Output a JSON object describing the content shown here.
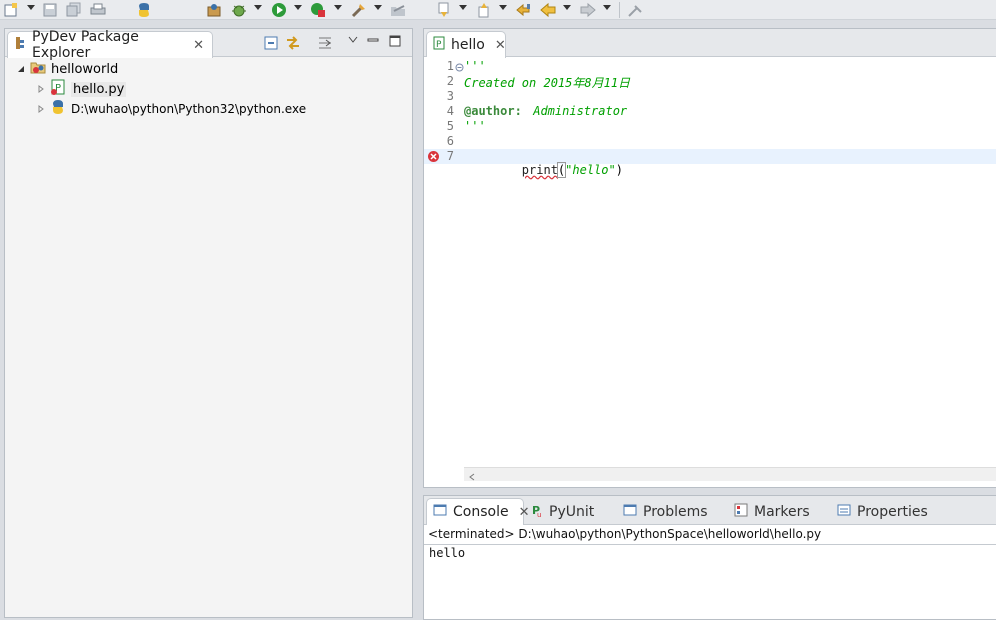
{
  "toolbar": {
    "items": [
      "new-icon",
      "save-icon",
      "save-all-icon",
      "print-icon",
      "python-icon",
      "package-icon",
      "debug-icon",
      "run-icon",
      "coverage-icon",
      "external-tools-icon",
      "open-icon",
      "next-annotation-icon",
      "prev-annotation-icon",
      "last-edit-icon",
      "back-icon",
      "forward-icon",
      "pin-icon"
    ]
  },
  "explorer": {
    "tab_label": "PyDev Package Explorer",
    "project": "helloworld",
    "file": "hello.py",
    "interpreter": "D:\\wuhao\\python\\Python32\\python.exe"
  },
  "editor": {
    "tab_label": "hello",
    "lines": [
      {
        "n": "1",
        "text": "'''"
      },
      {
        "n": "2",
        "text": "Created on 2015年8月11日"
      },
      {
        "n": "3",
        "text": ""
      },
      {
        "n": "4",
        "text_tag": "@author:",
        "text_rest": " Administrator"
      },
      {
        "n": "5",
        "text": "'''"
      },
      {
        "n": "6",
        "text": ""
      },
      {
        "n": "7",
        "code_fn": "print",
        "code_open": "(",
        "code_str": "\"hello\"",
        "code_close": ")"
      }
    ]
  },
  "bottom": {
    "tabs": {
      "console": "Console",
      "pyunit": "PyUnit",
      "problems": "Problems",
      "markers": "Markers",
      "properties": "Properties"
    },
    "status": "<terminated> D:\\wuhao\\python\\PythonSpace\\helloworld\\hello.py",
    "output": "hello"
  },
  "colors": {
    "accent": "#2e63c5",
    "comment": "#00a000",
    "error": "#d9343c"
  }
}
